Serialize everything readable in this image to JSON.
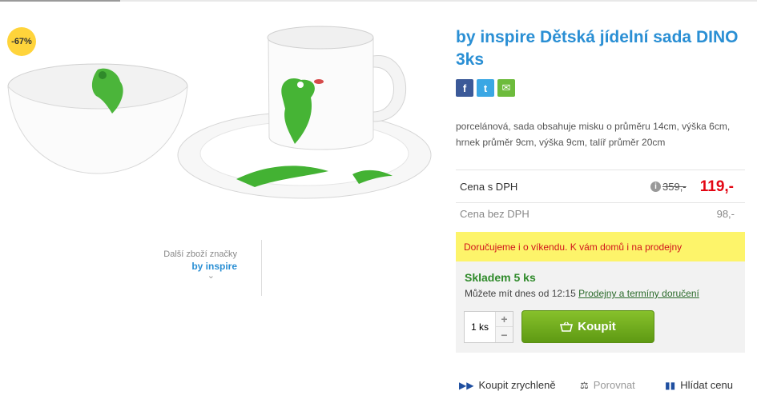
{
  "product": {
    "title": "by inspire Dětská jídelní sada DINO 3ks",
    "discount_badge": "-67%",
    "description": "porcelánová, sada obsahuje misku o průměru 14cm, výška 6cm, hrnek průměr 9cm, výška 9cm, talíř průměr 20cm"
  },
  "brand": {
    "more_label": "Další zboží značky",
    "name": "by inspire",
    "chevron": "⌄"
  },
  "share": {
    "facebook": "f",
    "twitter": "t",
    "email": "✉"
  },
  "pricing": {
    "vat_label": "Cena s DPH",
    "info_icon": "i",
    "old_price": "359,-",
    "price": "119,-",
    "novat_label": "Cena bez DPH",
    "novat_price": "98,-"
  },
  "delivery": {
    "banner": "Doručujeme i o víkendu. K vám domů i na prodejny"
  },
  "stock": {
    "status": "Skladem 5 ks",
    "note_prefix": "Můžete mít dnes od 12:15",
    "note_link": "Prodejny a termíny doručení"
  },
  "cart": {
    "quantity": "1 ks",
    "plus": "+",
    "minus": "−",
    "buy_label": "Koupit",
    "basket_icon": "basket-icon"
  },
  "actions": {
    "quick_buy": "Koupit zrychleně",
    "compare": "Porovnat",
    "watch_price": "Hlídat cenu"
  },
  "colors": {
    "accent_blue": "#2a8fd4",
    "price_red": "#e30613",
    "stock_green": "#2f8a2a",
    "buy_green": "#76b023",
    "banner_yellow": "#fdf46a",
    "badge_yellow": "#ffd43b"
  }
}
